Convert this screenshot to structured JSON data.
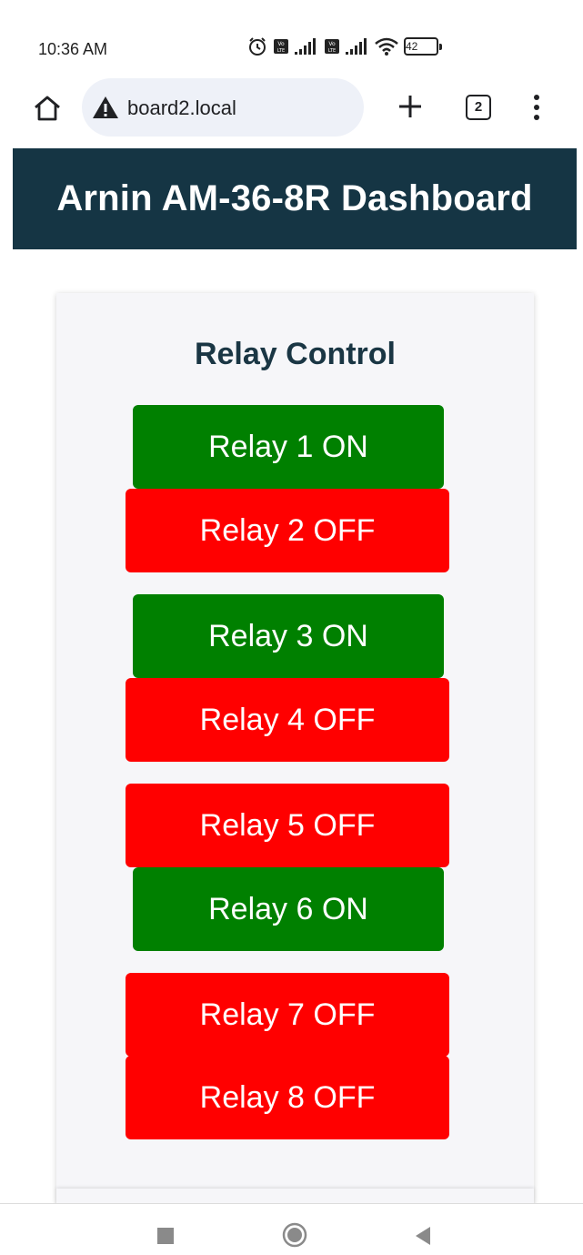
{
  "status_bar": {
    "time": "10:36 AM",
    "battery": "42"
  },
  "browser": {
    "url": "board2.local",
    "tab_count": "2"
  },
  "header": {
    "title": "Arnin AM-36-8R Dashboard"
  },
  "relay_panel": {
    "title": "Relay Control",
    "relays": [
      {
        "label": "Relay 1 ON",
        "state": "on"
      },
      {
        "label": "Relay 2 OFF",
        "state": "off"
      },
      {
        "label": "Relay 3 ON",
        "state": "on"
      },
      {
        "label": "Relay 4 OFF",
        "state": "off"
      },
      {
        "label": "Relay 5 OFF",
        "state": "off"
      },
      {
        "label": "Relay 6 ON",
        "state": "on"
      },
      {
        "label": "Relay 7 OFF",
        "state": "off"
      },
      {
        "label": "Relay 8 OFF",
        "state": "off"
      }
    ]
  },
  "colors": {
    "header_bg": "#153544",
    "on": "#008000",
    "off": "#ff0000",
    "title_text": "#1a3644"
  }
}
